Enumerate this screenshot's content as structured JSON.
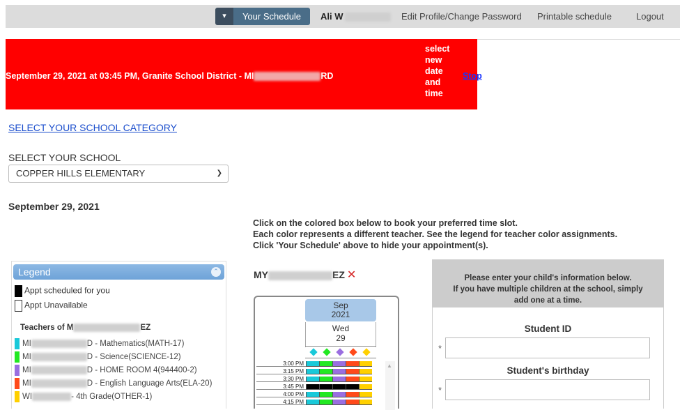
{
  "nav": {
    "toggle": "▾",
    "your_schedule": "Your Schedule",
    "user": "Ali W",
    "edit_profile": "Edit Profile/Change Password",
    "printable": "Printable schedule",
    "logout": "Logout"
  },
  "banner": {
    "text_prefix": "September 29, 2021 at 03:45 PM, Granite School District - MI",
    "text_suffix": "RD",
    "select_new": "select new date and time",
    "stop": "Stop"
  },
  "school_category_link": "SELECT YOUR SCHOOL CATEGORY",
  "school_label": "SELECT YOUR SCHOOL",
  "school_selected": "COPPER HILLS ELEMENTARY",
  "date_heading": "September 29, 2021",
  "instructions": [
    "Click on the colored box below to book your preferred time slot.",
    "Each color represents a different teacher. See the legend for teacher color assignments.",
    "Click 'Your Schedule' above to hide your appointment(s)."
  ],
  "legend": {
    "title": "Legend",
    "scheduled": "Appt scheduled for you",
    "unavailable": "Appt Unavailable",
    "teachers_title_prefix": "Teachers of M",
    "teachers_title_suffix": "EZ",
    "teachers": [
      {
        "prefix": "MI",
        "label": "D - Mathematics(MATH-17)",
        "color": "#19c9d9"
      },
      {
        "prefix": "MI",
        "label": "D - Science(SCIENCE-12)",
        "color": "#22e822"
      },
      {
        "prefix": "MI",
        "label": "D - HOME ROOM 4(944400-2)",
        "color": "#9a6ee0"
      },
      {
        "prefix": "MI",
        "label": "D - English Language Arts(ELA-20)",
        "color": "#ff4a1a"
      },
      {
        "prefix": "WI",
        "label": "- 4th Grade(OTHER-1)",
        "color": "#ffd000"
      }
    ]
  },
  "student": {
    "name_prefix": "MY",
    "name_suffix": "EZ",
    "remove": "✕"
  },
  "calendar": {
    "month": "Sep",
    "year": "2021",
    "weekday": "Wed",
    "day": "29",
    "times": [
      "3:00 PM",
      "3:15 PM",
      "3:30 PM",
      "3:45 PM",
      "4:00 PM",
      "4:15 PM"
    ]
  },
  "form": {
    "intro": [
      "Please enter your child's information below.",
      "If you have multiple children at the school, simply",
      "add one at a time."
    ],
    "student_id_label": "Student ID",
    "birthday_label": "Student's birthday",
    "required_mark": "*"
  }
}
